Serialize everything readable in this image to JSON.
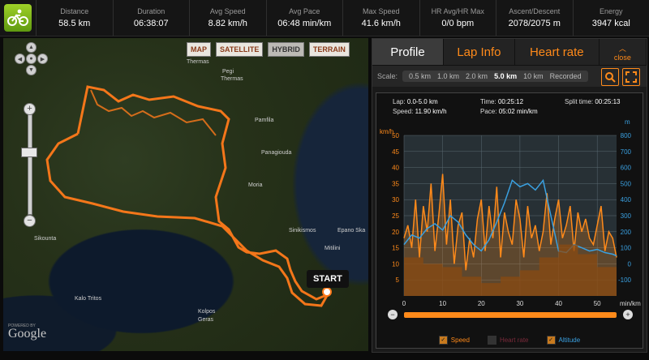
{
  "stats": [
    {
      "label": "Distance",
      "value": "58.5 km"
    },
    {
      "label": "Duration",
      "value": "06:38:07"
    },
    {
      "label": "Avg Speed",
      "value": "8.82 km/h"
    },
    {
      "label": "Avg Pace",
      "value": "06:48 min/km"
    },
    {
      "label": "Max Speed",
      "value": "41.6 km/h"
    },
    {
      "label": "HR Avg/HR Max",
      "value": "0/0 bpm"
    },
    {
      "label": "Ascent/Descent",
      "value": "2078/2075 m"
    },
    {
      "label": "Energy",
      "value": "3947 kcal"
    }
  ],
  "map": {
    "types": [
      "MAP",
      "SATELLITE",
      "HYBRID",
      "TERRAIN"
    ],
    "selected_type": "HYBRID",
    "start_label": "START",
    "attribution": "Google",
    "powered_by": "POWERED BY",
    "places": [
      "Thermas",
      "Pegi",
      "Thermas",
      "Pamfila",
      "Panagiouda",
      "Moria",
      "Sinikismos",
      "Epano Ska",
      "Mitilini",
      "Sikounta",
      "Kalo Tritos",
      "Kolpos",
      "Geras"
    ]
  },
  "panel": {
    "tabs": [
      "Profile",
      "Lap Info",
      "Heart rate"
    ],
    "active_tab": "Profile",
    "close_label": "close",
    "scale_label": "Scale:",
    "scale_options": [
      "0.5 km",
      "1.0 km",
      "2.0 km",
      "5.0 km",
      "10 km",
      "Recorded"
    ],
    "scale_selected": "5.0 km"
  },
  "lap": {
    "lap_label": "Lap:",
    "lap_value": "0.0-5.0 km",
    "speed_label": "Speed:",
    "speed_value": "11.90 km/h",
    "time_label": "Time:",
    "time_value": "00:25:12",
    "pace_label": "Pace:",
    "pace_value": "05:02 min/km",
    "split_label": "Split time:",
    "split_value": "00:25:13"
  },
  "colors": {
    "accent": "#ff8a1a",
    "speed": "#ff8a1a",
    "altitude": "#3aa0e0",
    "route": "#ff7a1a"
  },
  "chart_data": {
    "type": "line",
    "left_axis_unit": "km/h",
    "right_axis_unit": "m",
    "x_axis_unit": "min/km",
    "left_ticks": [
      50,
      45,
      40,
      35,
      30,
      25,
      20,
      15,
      10,
      5
    ],
    "right_ticks": [
      800,
      700,
      600,
      500,
      400,
      300,
      200,
      100,
      0,
      -100
    ],
    "x_ticks": [
      0,
      10,
      20,
      30,
      40,
      50
    ],
    "xlim": [
      0,
      55
    ],
    "ylim_left": [
      0,
      50
    ],
    "ylim_right": [
      -200,
      800
    ],
    "series": [
      {
        "name": "Speed",
        "axis": "left",
        "color": "#ff8a1a",
        "x": [
          0,
          1,
          2,
          3,
          4,
          5,
          6,
          7,
          8,
          9,
          10,
          11,
          12,
          13,
          14,
          15,
          16,
          17,
          18,
          19,
          20,
          21,
          22,
          23,
          24,
          25,
          26,
          27,
          28,
          29,
          30,
          31,
          32,
          33,
          34,
          35,
          36,
          37,
          38,
          39,
          40,
          41,
          42,
          43,
          44,
          45,
          46,
          47,
          48,
          49,
          50,
          51,
          52,
          53,
          54,
          55
        ],
        "values": [
          18,
          22,
          15,
          30,
          12,
          28,
          20,
          35,
          14,
          25,
          38,
          16,
          30,
          10,
          22,
          26,
          8,
          18,
          12,
          24,
          30,
          14,
          28,
          18,
          34,
          12,
          26,
          20,
          16,
          30,
          24,
          12,
          28,
          18,
          22,
          14,
          20,
          32,
          16,
          24,
          30,
          18,
          22,
          28,
          14,
          26,
          20,
          24,
          18,
          16,
          22,
          28,
          14,
          20,
          18,
          12
        ]
      },
      {
        "name": "Altitude",
        "axis": "right",
        "color": "#3aa0e0",
        "x": [
          0,
          2,
          4,
          6,
          8,
          10,
          12,
          14,
          16,
          18,
          20,
          22,
          24,
          26,
          28,
          30,
          32,
          34,
          36,
          38,
          40,
          42,
          44,
          46,
          48,
          50,
          52,
          54,
          55
        ],
        "values": [
          120,
          180,
          160,
          220,
          250,
          210,
          300,
          260,
          180,
          120,
          80,
          150,
          260,
          380,
          520,
          480,
          500,
          460,
          520,
          300,
          80,
          70,
          120,
          100,
          80,
          90,
          70,
          60,
          50
        ]
      },
      {
        "name": "Lap Speed",
        "axis": "left",
        "color": "#8a4a12",
        "x": [
          0,
          5,
          5,
          10,
          10,
          15,
          15,
          20,
          20,
          25,
          25,
          30,
          30,
          35,
          35,
          40,
          40,
          45,
          45,
          50,
          50,
          55
        ],
        "values": [
          12,
          12,
          10,
          10,
          9,
          9,
          6,
          6,
          4,
          4,
          6,
          6,
          8,
          8,
          12,
          12,
          16,
          16,
          13,
          13,
          9,
          9
        ]
      }
    ],
    "legend": [
      {
        "name": "Speed",
        "checked": true,
        "color": "#ff8a1a"
      },
      {
        "name": "Heart rate",
        "checked": false,
        "color": "#7a2a3a"
      },
      {
        "name": "Altitude",
        "checked": true,
        "color": "#3aa0e0"
      }
    ]
  }
}
